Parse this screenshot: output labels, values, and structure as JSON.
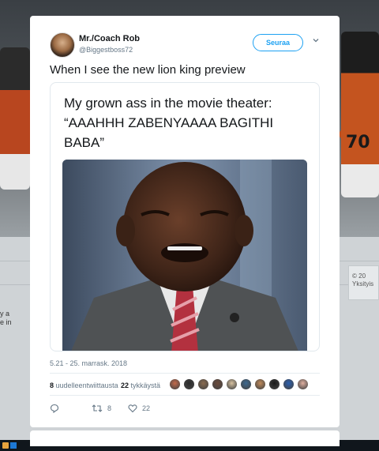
{
  "background": {
    "side_left_text": [
      "y a",
      "e in"
    ],
    "side_right_text": [
      "© 20",
      "Yksityis"
    ]
  },
  "tweet": {
    "author_name": "Mr./Coach Rob",
    "author_handle": "@Biggestboss72",
    "follow_label": "Seuraa",
    "text": "When I see the new lion king preview",
    "media_caption_line1": "My grown ass in the movie theater:",
    "media_caption_line2": "“AAAHHH ZABENYAAAA BAGITHI",
    "media_caption_line3": "BABA”",
    "timestamp": "5.21 - 25. marrask. 2018",
    "retweets_count": "8",
    "retweets_label": "uudelleentwiittausta",
    "likes_count": "22",
    "likes_label": "tykkäystä",
    "reply_count": "",
    "retweet_action_count": "8",
    "like_action_count": "22"
  },
  "likers": [
    "#c46a4b",
    "#2b2b2b",
    "#8a6b4f",
    "#6a4a3a",
    "#d8c2a0",
    "#3d6a91",
    "#c08a5a",
    "#1b1b1b",
    "#2a5fb0",
    "#e0b0a0"
  ],
  "colors": {
    "accent": "#1da1f2",
    "text": "#14171a",
    "muted": "#657786"
  }
}
